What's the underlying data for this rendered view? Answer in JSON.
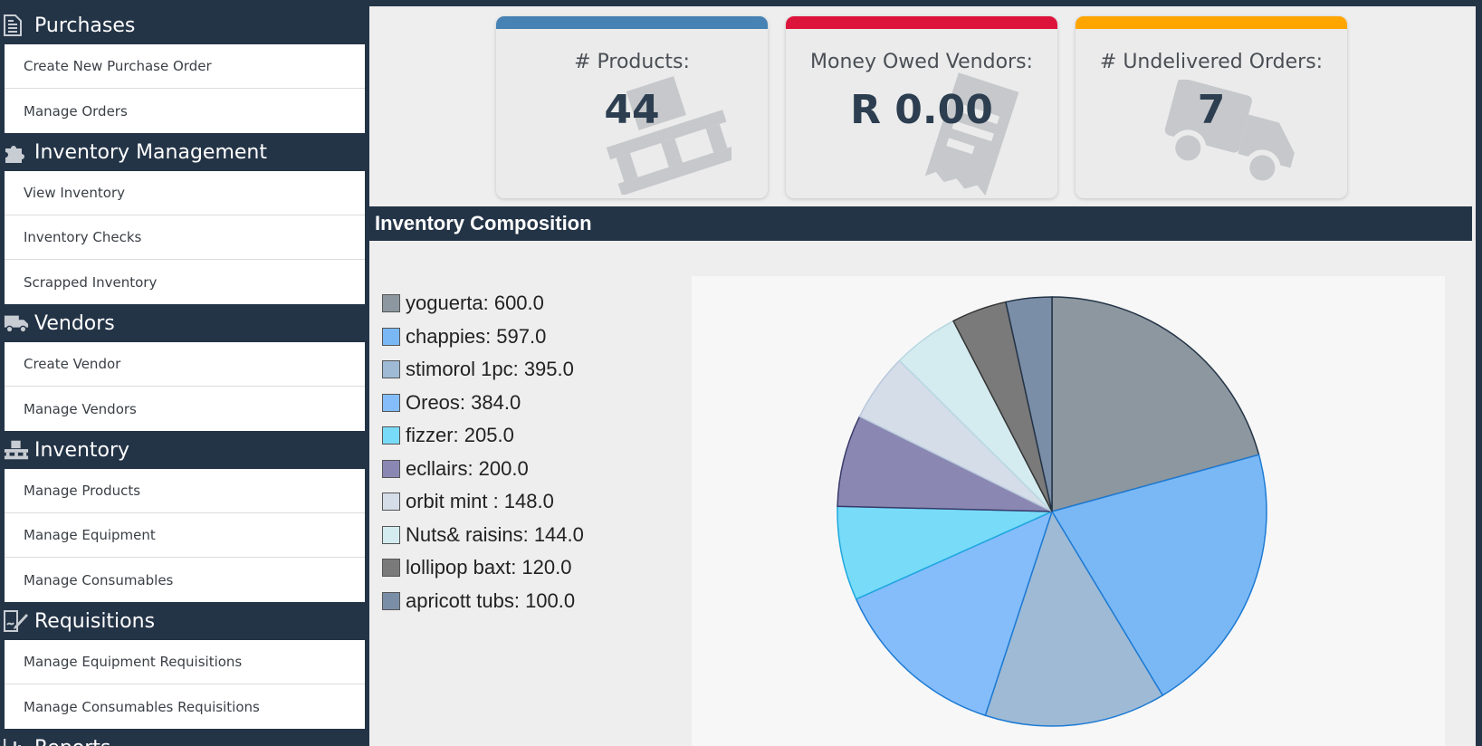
{
  "sidebar": {
    "sections": [
      {
        "title": "Purchases",
        "icon": "document-icon",
        "items": [
          "Create New Purchase Order",
          "Manage Orders"
        ]
      },
      {
        "title": "Inventory Management",
        "icon": "puzzle-icon",
        "items": [
          "View Inventory",
          "Inventory Checks",
          "Scrapped Inventory"
        ]
      },
      {
        "title": "Vendors",
        "icon": "truck-icon",
        "items": [
          "Create Vendor",
          "Manage Vendors"
        ]
      },
      {
        "title": "Inventory",
        "icon": "pallet-icon",
        "items": [
          "Manage Products",
          "Manage Equipment",
          "Manage Consumables"
        ]
      },
      {
        "title": "Requisitions",
        "icon": "signature-icon",
        "items": [
          "Manage Equipment Requisitions",
          "Manage Consumables Requisitions"
        ]
      },
      {
        "title": "Reports",
        "icon": "bar-chart-icon",
        "items": []
      }
    ]
  },
  "cards": [
    {
      "label": "# Products:",
      "value": "44",
      "bar_color": "#4682b4",
      "icon": "pallet-icon"
    },
    {
      "label": "Money Owed Vendors:",
      "value": "R 0.00",
      "bar_color": "#dc143c",
      "icon": "receipt-icon"
    },
    {
      "label": "# Undelivered Orders:",
      "value": "7",
      "bar_color": "#ffa500",
      "icon": "truck-icon"
    }
  ],
  "composition": {
    "title": "Inventory Composition"
  },
  "chart_data": {
    "type": "pie",
    "title": "",
    "slices": [
      {
        "label": "yoguerta: 600.0",
        "name": "yoguerta",
        "value": 600.0,
        "fill": "#8c97a0",
        "stroke": "#243447"
      },
      {
        "label": "chappies: 597.0",
        "name": "chappies",
        "value": 597.0,
        "fill": "#7ab8f5",
        "stroke": "#1e7bd4"
      },
      {
        "label": "stimorol 1pc: 395.0",
        "name": "stimorol 1pc",
        "value": 395.0,
        "fill": "#9ebad5",
        "stroke": "#1e7bd4"
      },
      {
        "label": "Oreos: 384.0",
        "name": "Oreos",
        "value": 384.0,
        "fill": "#84bdfa",
        "stroke": "#1e7bd4"
      },
      {
        "label": "fizzer: 205.0",
        "name": "fizzer",
        "value": 205.0,
        "fill": "#78dbf7",
        "stroke": "#1fa8e0"
      },
      {
        "label": "ecllairs: 200.0",
        "name": "ecllairs",
        "value": 200.0,
        "fill": "#8a88b3",
        "stroke": "#3a3a6a"
      },
      {
        "label": "orbit mint : 148.0",
        "name": "orbit mint ",
        "value": 148.0,
        "fill": "#d4dde8",
        "stroke": "#b8c8dc"
      },
      {
        "label": "Nuts& raisins: 144.0",
        "name": "Nuts& raisins",
        "value": 144.0,
        "fill": "#d4ebf0",
        "stroke": "#b8d8e0"
      },
      {
        "label": "lollipop baxt: 120.0",
        "name": "lollipop baxt",
        "value": 120.0,
        "fill": "#7a7a7a",
        "stroke": "#333333"
      },
      {
        "label": "apricott tubs: 100.0",
        "name": "apricott tubs",
        "value": 100.0,
        "fill": "#7b8ea8",
        "stroke": "#243447"
      }
    ],
    "legend": "left"
  }
}
